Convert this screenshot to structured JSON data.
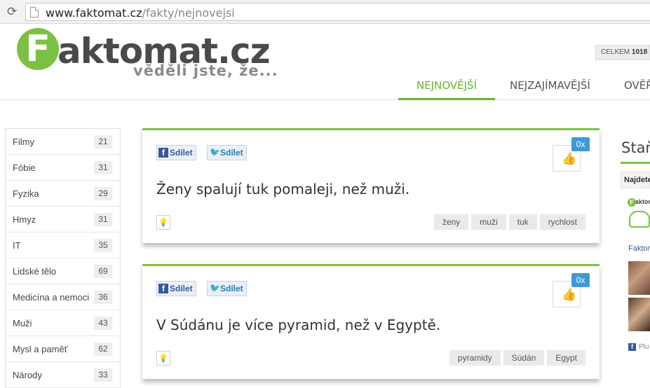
{
  "browser": {
    "url_host": "www.faktomat.cz",
    "url_path": "/fakty/nejnovejsi"
  },
  "header": {
    "logo_letter": "F",
    "logo_word": "aktomat.cz",
    "tagline": "věděli jste, že...",
    "total_label": "CELKEM",
    "total_value": "1018",
    "nav": [
      {
        "label": "NEJNOVĚJŠÍ",
        "active": true
      },
      {
        "label": "NEJZAJÍMAVĚJŠÍ",
        "active": false
      },
      {
        "label": "OVĚŘ",
        "active": false
      }
    ]
  },
  "categories": [
    {
      "label": "Filmy",
      "count": "21"
    },
    {
      "label": "Fóbie",
      "count": "31"
    },
    {
      "label": "Fyzika",
      "count": "29"
    },
    {
      "label": "Hmyz",
      "count": "31"
    },
    {
      "label": "IT",
      "count": "35"
    },
    {
      "label": "Lidské tělo",
      "count": "69"
    },
    {
      "label": "Medicína a nemoci",
      "count": "36"
    },
    {
      "label": "Muži",
      "count": "43"
    },
    {
      "label": "Mysl a paměť",
      "count": "62"
    },
    {
      "label": "Národy",
      "count": "33"
    }
  ],
  "share": {
    "facebook_label": "Sdílet",
    "twitter_label": "Sdílet"
  },
  "facts": [
    {
      "text": "Ženy spalují tuk pomaleji, než muži.",
      "likes": "0x",
      "tags": [
        "ženy",
        "muži",
        "tuk",
        "rychlost"
      ]
    },
    {
      "text": "V Súdánu je více pyramid, než v Egyptě.",
      "likes": "0x",
      "tags": [
        "pyramidy",
        "Súdán",
        "Egypt"
      ]
    }
  ],
  "right_column": {
    "title": "Staň",
    "box_label": "Najdete",
    "mini_logo_letter": "F",
    "mini_logo_word": "aktomat",
    "facebook_name": "Faktom",
    "plugin_label": "Plu"
  },
  "icons": {
    "reload": "reload-icon",
    "page": "page-icon",
    "thumbs_up": "thumbs-up-icon",
    "bulb": "lightbulb-icon",
    "facebook": "facebook-icon",
    "twitter": "twitter-icon"
  },
  "colors": {
    "brand_green": "#7cc143",
    "nav_active": "#6ab431",
    "like_badge": "#3d9ad6",
    "facebook_blue": "#3b5998"
  }
}
